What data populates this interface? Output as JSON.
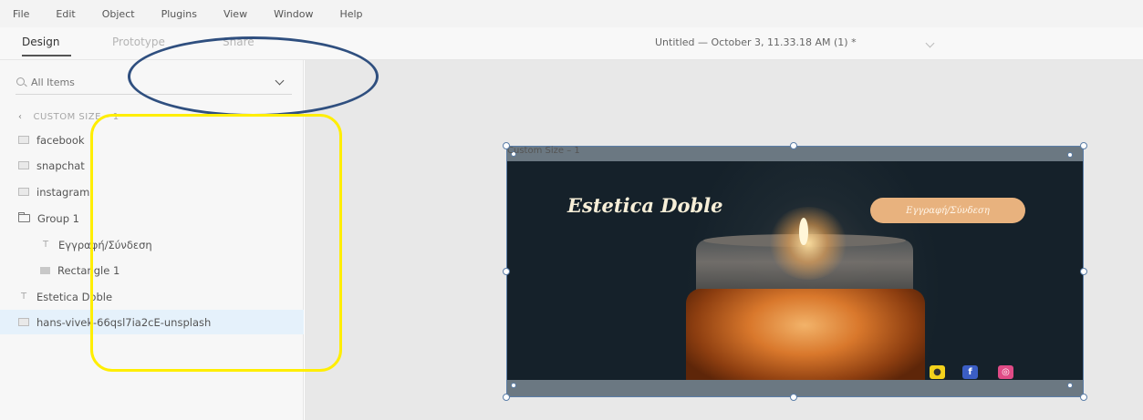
{
  "menubar": {
    "items": [
      "File",
      "Edit",
      "Object",
      "Plugins",
      "View",
      "Window",
      "Help"
    ]
  },
  "tabs": {
    "design": "Design",
    "prototype": "Prototype",
    "share": "Share"
  },
  "document": {
    "title": "Untitled — October 3, 11.33.18 AM (1) *"
  },
  "layers_panel": {
    "search_placeholder": "All Items",
    "breadcrumb": "CUSTOM SIZE – 1",
    "items": [
      {
        "label": "facebook",
        "icon": "image-icon"
      },
      {
        "label": "snapchat",
        "icon": "image-icon"
      },
      {
        "label": "instagram",
        "icon": "image-icon"
      },
      {
        "label": "Group 1",
        "icon": "folder-icon"
      },
      {
        "label": "Εγγραφή/Σύνδεση",
        "icon": "text-icon"
      },
      {
        "label": "Rectangle 1",
        "icon": "rectangle-icon"
      },
      {
        "label": "Estetica Doble",
        "icon": "text-icon"
      },
      {
        "label": "hans-vivek-66qsl7ia2cE-unsplash",
        "icon": "image-icon",
        "selected": true
      }
    ]
  },
  "artboard": {
    "label": "Custom Size – 1",
    "brand_title": "Estetica Doble",
    "signup_button": "Εγγραφή/Σύνδεση",
    "social_icons": [
      "snapchat-icon",
      "facebook-icon",
      "instagram-icon"
    ]
  },
  "annotations": {
    "ellipse_color": "#2f4f7f",
    "rectangle_color": "#ffee00"
  },
  "colors": {
    "selection": "#e5f1fb",
    "artboard_border": "#5b7ea8",
    "button": "#e8b27e"
  }
}
